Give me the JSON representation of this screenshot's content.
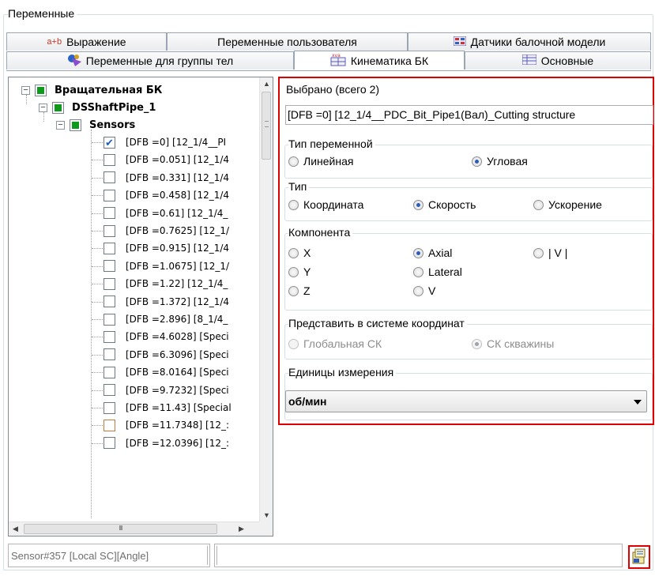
{
  "group_title": "Переменные",
  "tabs_row1": [
    {
      "label": "Выражение",
      "icon": "a+b-expression-icon"
    },
    {
      "label": "Переменные пользователя",
      "icon": ""
    },
    {
      "label": "Датчики балочной модели",
      "icon": "beam-sensors-icon"
    }
  ],
  "tabs_row2": [
    {
      "label": "Переменные для группы тел",
      "icon": "body-group-icon"
    },
    {
      "label": "Кинематика БК",
      "icon": "kinematics-icon",
      "active": true
    },
    {
      "label": "Основные",
      "icon": "main-table-icon"
    }
  ],
  "tree": {
    "root": "Вращательная БК",
    "child": "DSShaftPipe_1",
    "sensors": "Sensors",
    "items": [
      {
        "text": "[DFB =0] [12_1/4__PI",
        "checked": true
      },
      {
        "text": "[DFB =0.051] [12_1/4",
        "checked": false
      },
      {
        "text": "[DFB =0.331] [12_1/4",
        "checked": false
      },
      {
        "text": "[DFB =0.458] [12_1/4",
        "checked": false
      },
      {
        "text": "[DFB =0.61] [12_1/4_",
        "checked": false
      },
      {
        "text": "[DFB =0.7625] [12_1/",
        "checked": false
      },
      {
        "text": "[DFB =0.915] [12_1/4",
        "checked": false
      },
      {
        "text": "[DFB =1.0675] [12_1/",
        "checked": false
      },
      {
        "text": "[DFB =1.22] [12_1/4_",
        "checked": false
      },
      {
        "text": "[DFB =1.372] [12_1/4",
        "checked": false
      },
      {
        "text": "[DFB =2.896] [8_1/4_",
        "checked": false
      },
      {
        "text": "[DFB =4.6028] [Speci",
        "checked": false
      },
      {
        "text": "[DFB =6.3096] [Speci",
        "checked": false
      },
      {
        "text": "[DFB =8.0164] [Speci",
        "checked": false
      },
      {
        "text": "[DFB =9.7232] [Speci",
        "checked": false
      },
      {
        "text": "[DFB =11.43] [Special",
        "checked": false
      },
      {
        "text": "[DFB =11.7348] [12_:",
        "checked": false,
        "highlight": true
      },
      {
        "text": "[DFB =12.0396] [12_:",
        "checked": false
      }
    ],
    "hscroll_grip": "III"
  },
  "panel": {
    "selected_label": "Выбрано (всего 2)",
    "selected_value": "[DFB =0] [12_1/4__PDC_Bit_Pipe1(Вал)_Cutting structure",
    "var_type": {
      "title": "Тип переменной",
      "options": [
        "Линейная",
        "Угловая"
      ],
      "selected": 1
    },
    "type": {
      "title": "Тип",
      "options": [
        "Координата",
        "Скорость",
        "Ускорение"
      ],
      "selected": 1
    },
    "component": {
      "title": "Компонента",
      "options": [
        "X",
        "Axial",
        "| V |",
        "Y",
        "Lateral",
        "Z",
        "V"
      ],
      "selected": 1
    },
    "coord_system": {
      "title": "Представить в системе координат",
      "options": [
        "Глобальная СК",
        "СК скважины"
      ],
      "selected": 1,
      "disabled": true
    },
    "units": {
      "title": "Единицы измерения",
      "value": "об/мин"
    }
  },
  "status": {
    "left_text": "Sensor#357 [Local SC][Angle]"
  },
  "accent": "#e10000",
  "check_green": "#0f9a1e"
}
